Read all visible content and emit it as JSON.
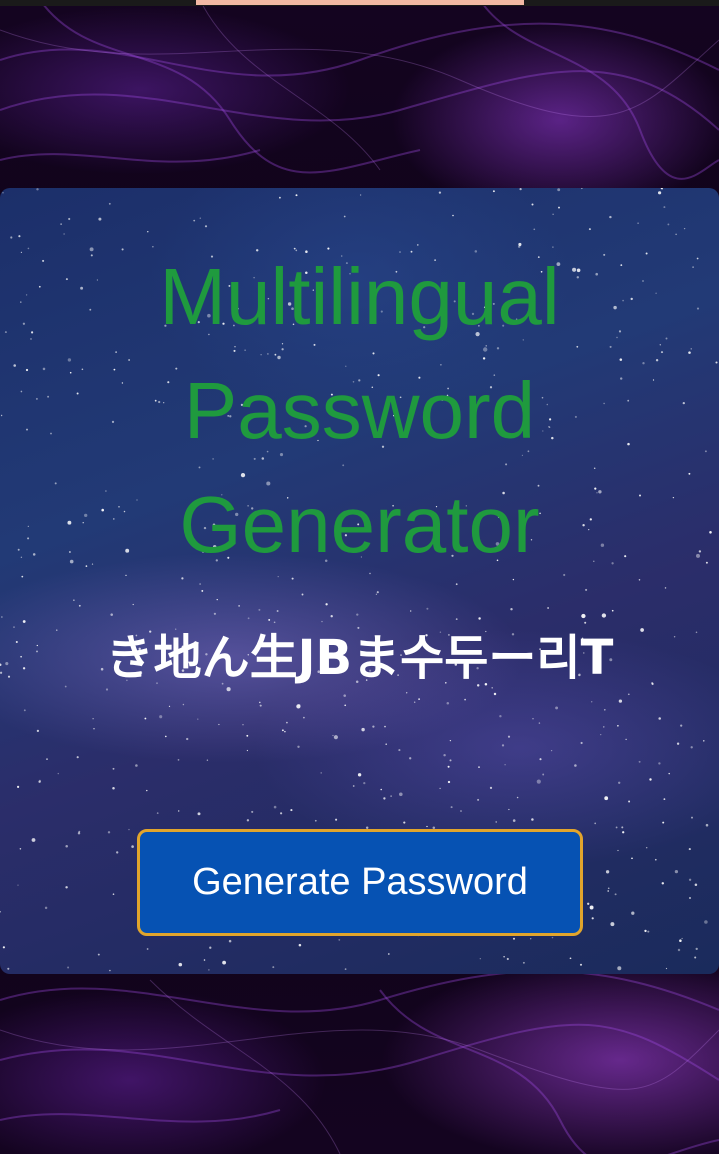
{
  "app": {
    "title": "Multilingual Password Generator"
  },
  "generator": {
    "password": "き地ん生JBま수두ー리T",
    "button_label": "Generate Password"
  },
  "colors": {
    "title": "#1f9a3e",
    "button_background": "#0652b3",
    "button_border": "#e1a52c",
    "password_text": "#ffffff"
  }
}
